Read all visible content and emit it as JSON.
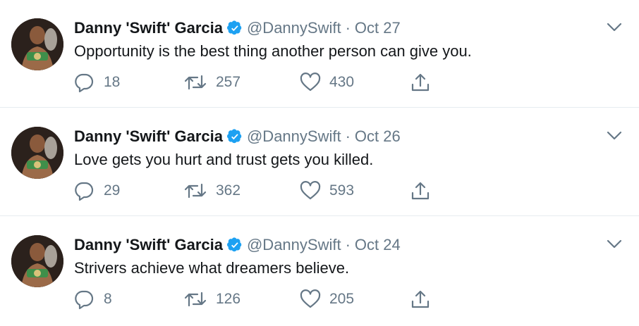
{
  "tweets": [
    {
      "name": "Danny 'Swift' Garcia",
      "handle": "@DannySwift",
      "separator": "·",
      "date": "Oct 27",
      "text": "Opportunity is the best thing another person can give you.",
      "replies": "18",
      "retweets": "257",
      "likes": "430"
    },
    {
      "name": "Danny 'Swift' Garcia",
      "handle": "@DannySwift",
      "separator": "·",
      "date": "Oct 26",
      "text": "Love gets you hurt and trust gets you killed.",
      "replies": "29",
      "retweets": "362",
      "likes": "593"
    },
    {
      "name": "Danny 'Swift' Garcia",
      "handle": "@DannySwift",
      "separator": "·",
      "date": "Oct 24",
      "text": "Strivers achieve what dreamers believe.",
      "replies": "8",
      "retweets": "126",
      "likes": "205"
    }
  ],
  "colors": {
    "verified": "#1da1f2",
    "secondary_text": "#657786",
    "primary_text": "#14171a",
    "divider": "#e6ecf0"
  },
  "icons": [
    "verified-badge-icon",
    "chevron-down-icon",
    "reply-icon",
    "retweet-icon",
    "like-icon",
    "share-icon"
  ]
}
